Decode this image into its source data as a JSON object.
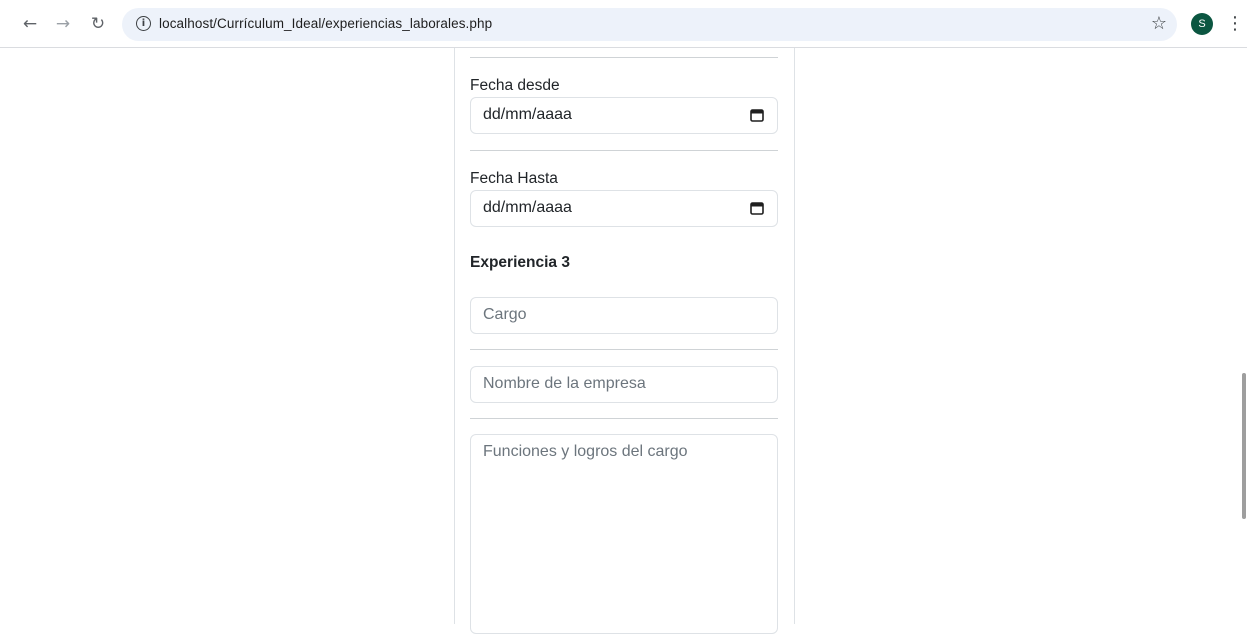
{
  "browser": {
    "url": "localhost/Currículum_Ideal/experiencias_laborales.php",
    "avatar_initial": "S",
    "back_glyph": "←",
    "forward_glyph": "→",
    "reload_glyph": "↻",
    "info_glyph": "i",
    "star_glyph": "☆",
    "menu_glyph": "⋮"
  },
  "form": {
    "fecha_desde": {
      "label": "Fecha desde",
      "value": "dd/mm/aaaa"
    },
    "fecha_hasta": {
      "label": "Fecha Hasta",
      "value": "dd/mm/aaaa"
    },
    "experiencia3": {
      "heading": "Experiencia 3",
      "cargo_placeholder": "Cargo",
      "empresa_placeholder": "Nombre de la empresa",
      "funciones_placeholder": "Funciones y logros del cargo"
    }
  },
  "colors": {
    "avatar_bg": "#0b5641",
    "omnibox_bg": "#edf2fa",
    "input_border": "#dee2e6",
    "placeholder": "#6c757d"
  }
}
